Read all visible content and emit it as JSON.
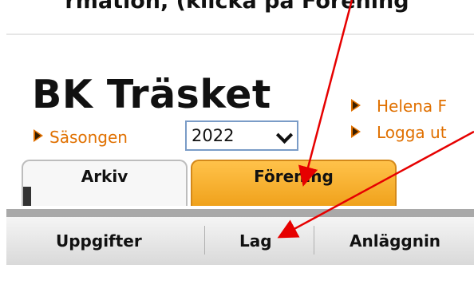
{
  "caption": "rmation, (klicka på Förening",
  "club": {
    "name": "BK Träsket"
  },
  "season": {
    "label": "Säsongen",
    "selected": "2022"
  },
  "user_links": {
    "user": "Helena F",
    "logout": "Logga ut"
  },
  "tabs": [
    {
      "label": "Arkiv",
      "active": false
    },
    {
      "label": "Förening",
      "active": true
    }
  ],
  "menu": [
    "Uppgifter",
    "Lag",
    "Anläggnin"
  ],
  "colors": {
    "accent": "#e07000",
    "annotation": "#e60000",
    "active_tab": "#f5a623"
  }
}
